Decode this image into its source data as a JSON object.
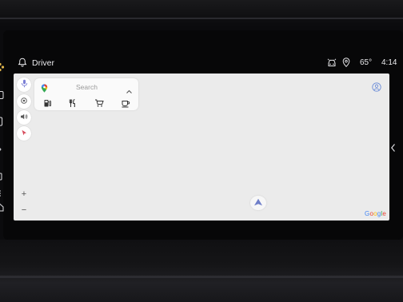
{
  "status_bar": {
    "profile_name": "Driver",
    "temperature": "65°",
    "time": "4:14",
    "icons": [
      "notification-bell-icon",
      "vehicle-icon",
      "location-icon"
    ]
  },
  "left_rail": {
    "icons": [
      "dots-logo-icon",
      "app-icon",
      "phone-icon",
      "climate-icon",
      "settings-icon",
      "media-icon",
      "home-icon"
    ]
  },
  "map": {
    "side_buttons": [
      "microphone-icon",
      "target-icon",
      "volume-icon",
      "pointer-icon"
    ],
    "zoom": {
      "in": "+",
      "out": "−"
    },
    "attribution": "Google",
    "brand_colors": {
      "blue": "#4285F4",
      "red": "#EA4335",
      "yellow": "#FBBC05",
      "green": "#34A853"
    },
    "nav_arrow_color": "#6f7fc9"
  },
  "search": {
    "placeholder": "Search",
    "categories": [
      "gas-station-icon",
      "restaurant-icon",
      "grocery-icon",
      "coffee-icon"
    ]
  }
}
